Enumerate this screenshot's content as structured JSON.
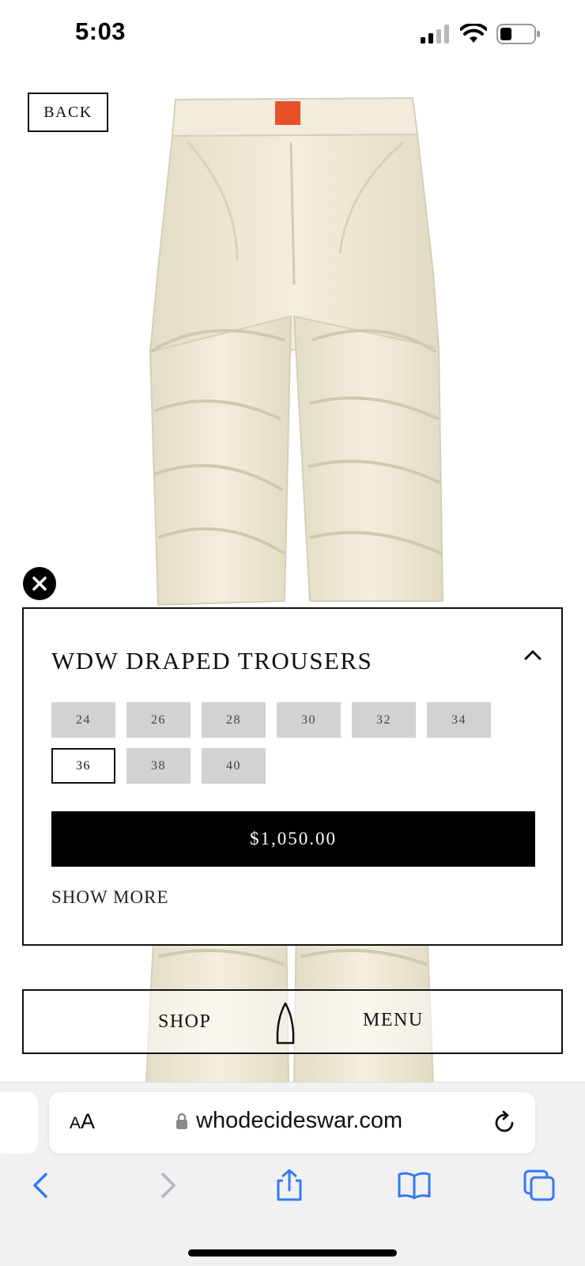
{
  "status": {
    "time": "5:03"
  },
  "back_label": "BACK",
  "product": {
    "title": "WDW DRAPED TROUSERS",
    "sizes_row1": [
      "24",
      "26",
      "28",
      "30",
      "32",
      "34"
    ],
    "sizes_row2": [
      "36",
      "38",
      "40"
    ],
    "selected_size": "36",
    "price": "$1,050.00",
    "show_more": "SHOW MORE"
  },
  "nav": {
    "shop": "SHOP",
    "menu": "MENU"
  },
  "browser": {
    "aa_small": "A",
    "aa_big": "A",
    "url": "whodecideswar.com"
  },
  "colors": {
    "accent_black": "#000000",
    "chip_gray": "#d2d2d2",
    "trousers": "#efe9d6",
    "label_orange": "#e8502a",
    "safari_blue": "#3478f6"
  },
  "icons": [
    "signal-icon",
    "wifi-icon",
    "battery-icon",
    "close-icon",
    "chevron-up-icon",
    "logo-icon",
    "lock-icon",
    "reload-icon",
    "back-arrow-icon",
    "forward-arrow-icon",
    "share-icon",
    "bookmarks-icon",
    "tabs-icon"
  ]
}
